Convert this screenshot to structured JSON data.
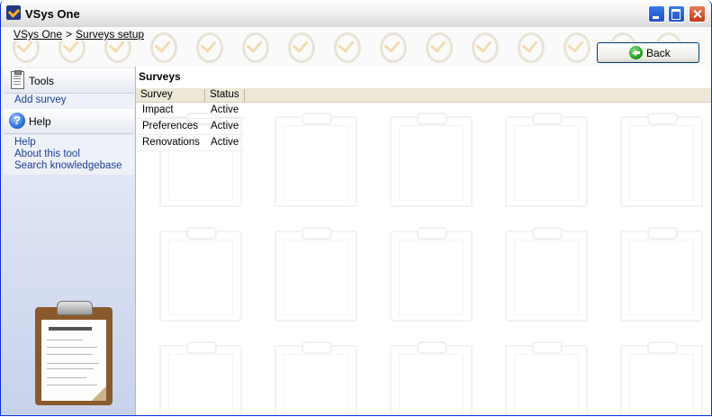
{
  "window": {
    "title": "VSys One",
    "controls": {
      "minimize": "minimize",
      "maximize": "maximize",
      "close": "close"
    }
  },
  "breadcrumb": {
    "home": "VSys One",
    "separator": ">",
    "current": "Surveys setup"
  },
  "toolbar": {
    "back_label": "Back"
  },
  "sidebar": {
    "tools_header": "Tools",
    "tools_items": [
      "Add survey"
    ],
    "help_header": "Help",
    "help_items": [
      "Help",
      "About this tool",
      "Search knowledgebase"
    ]
  },
  "main": {
    "title": "Surveys",
    "columns": [
      "Survey",
      "Status"
    ],
    "rows": [
      {
        "survey": "Impact",
        "status": "Active"
      },
      {
        "survey": "Preferences",
        "status": "Active"
      },
      {
        "survey": "Renovations",
        "status": "Active"
      }
    ]
  },
  "colors": {
    "window_border": "#0831d9",
    "link": "#1c3f9a",
    "grid_header": "#ece7d6",
    "back_icon": "#1e9b1e"
  },
  "icons": {
    "app": "vsys-logo-icon",
    "tools": "clipboard-icon",
    "help": "help-icon",
    "back": "back-arrow-icon"
  }
}
